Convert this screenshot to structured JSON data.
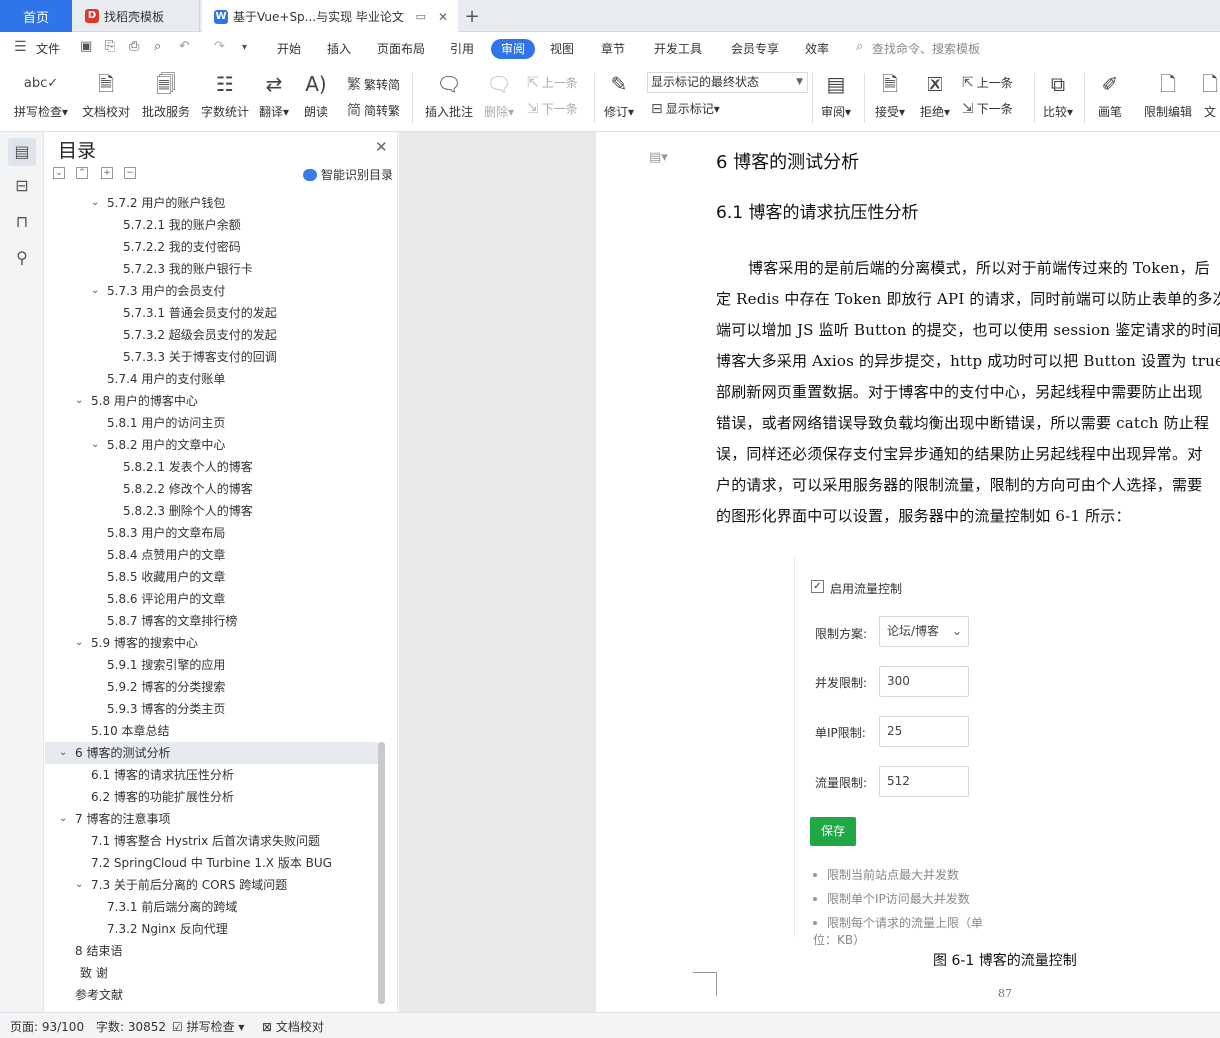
{
  "tabs": {
    "home": "首页",
    "daoke": "找稻壳模板",
    "doc": "基于Vue+Sp...与实现 毕业论文",
    "add": "+"
  },
  "menu": {
    "file": "文件",
    "items": [
      "开始",
      "插入",
      "页面布局",
      "引用",
      "审阅",
      "视图",
      "章节",
      "开发工具",
      "会员专享",
      "效率"
    ],
    "active": "审阅",
    "search": "查找命令、搜索模板"
  },
  "ribbon": {
    "spellcheck": "拼写检查",
    "doccheck": "文档校对",
    "batch": "批改服务",
    "wordcount": "字数统计",
    "translate": "翻译",
    "read": "朗读",
    "to_trad": "繁转简",
    "to_simp": "简转繁",
    "insert_comment": "插入批注",
    "delete": "删除",
    "prev_comment": "上一条",
    "next_comment": "下一条",
    "revise": "修订",
    "mark_state": "显示标记的最终状态",
    "show_marks": "显示标记",
    "review": "审阅",
    "accept": "接受",
    "reject": "拒绝",
    "prev": "上一条",
    "next": "下一条",
    "compare": "比较",
    "pen": "画笔",
    "restrict": "限制编辑",
    "more": "文"
  },
  "toc": {
    "title": "目录",
    "smart": "智能识别目录",
    "rows": [
      {
        "label": "5.7.2  用户的账户钱包",
        "lvl": 3,
        "chev": true
      },
      {
        "label": "5.7.2.1  我的账户余额",
        "lvl": 4
      },
      {
        "label": "5.7.2.2  我的支付密码",
        "lvl": 4
      },
      {
        "label": "5.7.2.3  我的账户银行卡",
        "lvl": 4
      },
      {
        "label": "5.7.3  用户的会员支付",
        "lvl": 3,
        "chev": true
      },
      {
        "label": "5.7.3.1  普通会员支付的发起",
        "lvl": 4
      },
      {
        "label": "5.7.3.2  超级会员支付的发起",
        "lvl": 4
      },
      {
        "label": "5.7.3.3  关于博客支付的回调",
        "lvl": 4
      },
      {
        "label": "5.7.4  用户的支付账单",
        "lvl": 3
      },
      {
        "label": "5.8  用户的博客中心",
        "lvl": 2,
        "chev": true
      },
      {
        "label": "5.8.1  用户的访问主页",
        "lvl": 3
      },
      {
        "label": "5.8.2  用户的文章中心",
        "lvl": 3,
        "chev": true
      },
      {
        "label": "5.8.2.1  发表个人的博客",
        "lvl": 4
      },
      {
        "label": "5.8.2.2  修改个人的博客",
        "lvl": 4
      },
      {
        "label": "5.8.2.3  删除个人的博客",
        "lvl": 4
      },
      {
        "label": "5.8.3  用户的文章布局",
        "lvl": 3
      },
      {
        "label": "5.8.4  点赞用户的文章",
        "lvl": 3
      },
      {
        "label": "5.8.5  收藏用户的文章",
        "lvl": 3
      },
      {
        "label": "5.8.6  评论用户的文章",
        "lvl": 3
      },
      {
        "label": "5.8.7  博客的文章排行榜",
        "lvl": 3
      },
      {
        "label": "5.9  博客的搜索中心",
        "lvl": 2,
        "chev": true
      },
      {
        "label": "5.9.1  搜索引擎的应用",
        "lvl": 3
      },
      {
        "label": "5.9.2  博客的分类搜索",
        "lvl": 3
      },
      {
        "label": "5.9.3  博客的分类主页",
        "lvl": 3
      },
      {
        "label": "5.10  本章总结",
        "lvl": 2
      },
      {
        "label": "6  博客的测试分析",
        "lvl": 1,
        "chev": true,
        "selected": true
      },
      {
        "label": "6.1  博客的请求抗压性分析",
        "lvl": 2
      },
      {
        "label": "6.2  博客的功能扩展性分析",
        "lvl": 2
      },
      {
        "label": "7  博客的注意事项",
        "lvl": 1,
        "chev": true
      },
      {
        "label": "7.1  博客整合 Hystrix 后首次请求失败问题",
        "lvl": 2
      },
      {
        "label": "7.2 SpringCloud 中 Turbine 1.X 版本 BUG",
        "lvl": 2
      },
      {
        "label": "7.3  关于前后分离的 CORS 跨域问题",
        "lvl": 2,
        "chev": true
      },
      {
        "label": "7.3.1  前后端分离的跨域",
        "lvl": 3
      },
      {
        "label": "7.3.2 Nginx 反向代理",
        "lvl": 3
      },
      {
        "label": "8  结束语",
        "lvl": 1
      },
      {
        "label": "致    谢",
        "lvl": 1,
        "shift": true
      },
      {
        "label": "参考文献",
        "lvl": 1
      }
    ]
  },
  "doc": {
    "h1": "6  博客的测试分析",
    "h2": "6.1  博客的请求抗压性分析",
    "lines": [
      "博客采用的是前后端的分离模式，所以对于前端传过来的 Token，后",
      "定 Redis 中存在 Token 即放行 API 的请求，同时前端可以防止表单的多次",
      "端可以增加 JS 监听 Button 的提交，也可以使用 session 鉴定请求的时间间",
      "博客大多采用 Axios 的异步提交，http 成功时可以把 Button 设置为 true 或",
      "部刷新网页重置数据。对于博客中的支付中心，另起线程中需要防止出现",
      "错误，或者网络错误导致负载均衡出现中断错误，所以需要 catch 防止程",
      "误，同样还必须保存支付宝异步通知的结果防止另起线程中出现异常。对",
      "户的请求，可以采用服务器的限制流量，限制的方向可由个人选择，需要",
      "的图形化界面中可以设置，服务器中的流量控制如 6-1 所示："
    ],
    "figure": {
      "enable": "启用流量控制",
      "scheme_label": "限制方案:",
      "scheme_value": "论坛/博客",
      "concurrent_label": "并发限制:",
      "concurrent_value": "300",
      "ip_label": "单IP限制:",
      "ip_value": "25",
      "flow_label": "流量限制:",
      "flow_value": "512",
      "save": "保存",
      "bullets": [
        "限制当前站点最大并发数",
        "限制单个IP访问最大并发数",
        "限制每个请求的流量上限（单位：KB）"
      ]
    },
    "caption": "图 6-1  博客的流量控制",
    "page_number": "87"
  },
  "status": {
    "page": "页面: 93/100",
    "words": "字数: 30852",
    "spell": "拼写检查",
    "doccheck": "文档校对"
  }
}
